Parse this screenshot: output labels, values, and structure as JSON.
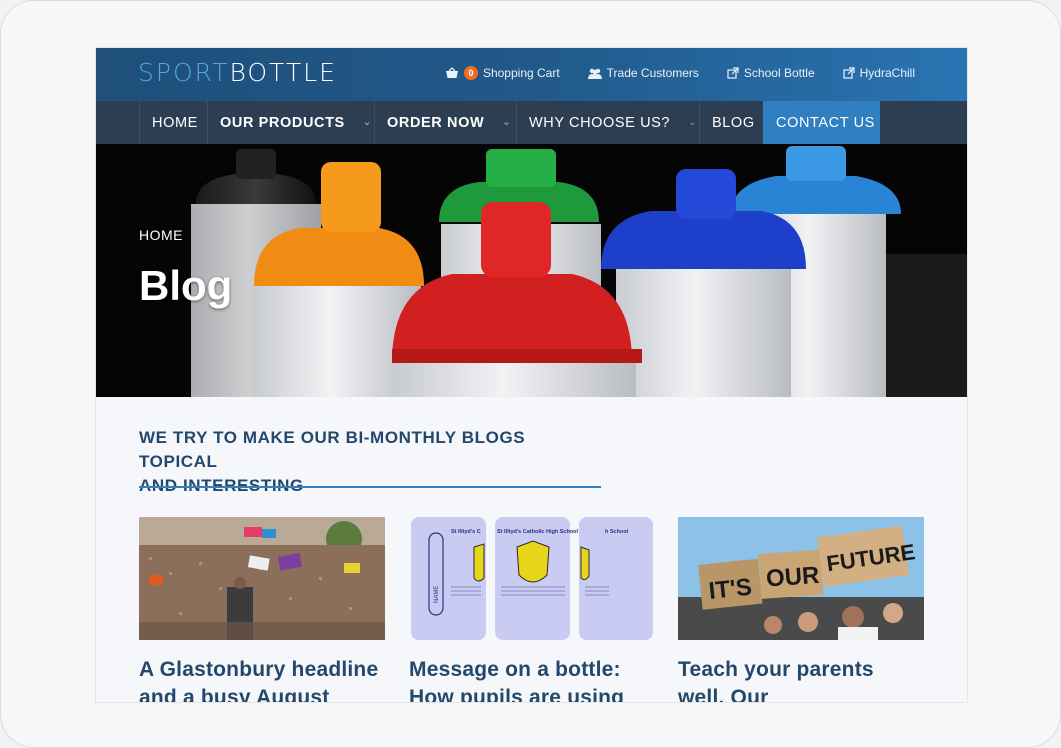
{
  "header": {
    "logo_part1": "SPORT",
    "logo_part2": "BOTTLE",
    "cart_count": "0",
    "links": {
      "cart": "Shopping Cart",
      "trade": "Trade Customers",
      "school": "School Bottle",
      "hydra": "HydraChill"
    }
  },
  "nav": {
    "home": "HOME",
    "products": "OUR PRODUCTS",
    "order": "ORDER NOW",
    "why": "WHY CHOOSE US?",
    "blog": "BLOG",
    "contact": "CONTACT US"
  },
  "hero": {
    "breadcrumb": "HOME",
    "title": "Blog"
  },
  "intro": {
    "line1": "WE TRY TO MAKE OUR BI-MONTHLY BLOGS TOPICAL",
    "line2": "AND INTERESTING"
  },
  "bottle_panel_texts": {
    "left": "St Illtyd's C",
    "mid": "St Illtyd's Catholic High School",
    "right": "h School",
    "name": "NAME"
  },
  "protest_signs": {
    "its": "IT'S",
    "our": "OUR",
    "future": "FUTURE"
  },
  "posts": [
    {
      "title": "A Glastonbury headline and a busy August"
    },
    {
      "title": "Message on a bottle: How pupils are using"
    },
    {
      "title": "Teach your parents well. Our"
    }
  ],
  "colors": {
    "accent": "#2f7fc1",
    "heading": "#24486b",
    "nav_bg": "#2d3e52",
    "badge": "#f26c21"
  }
}
